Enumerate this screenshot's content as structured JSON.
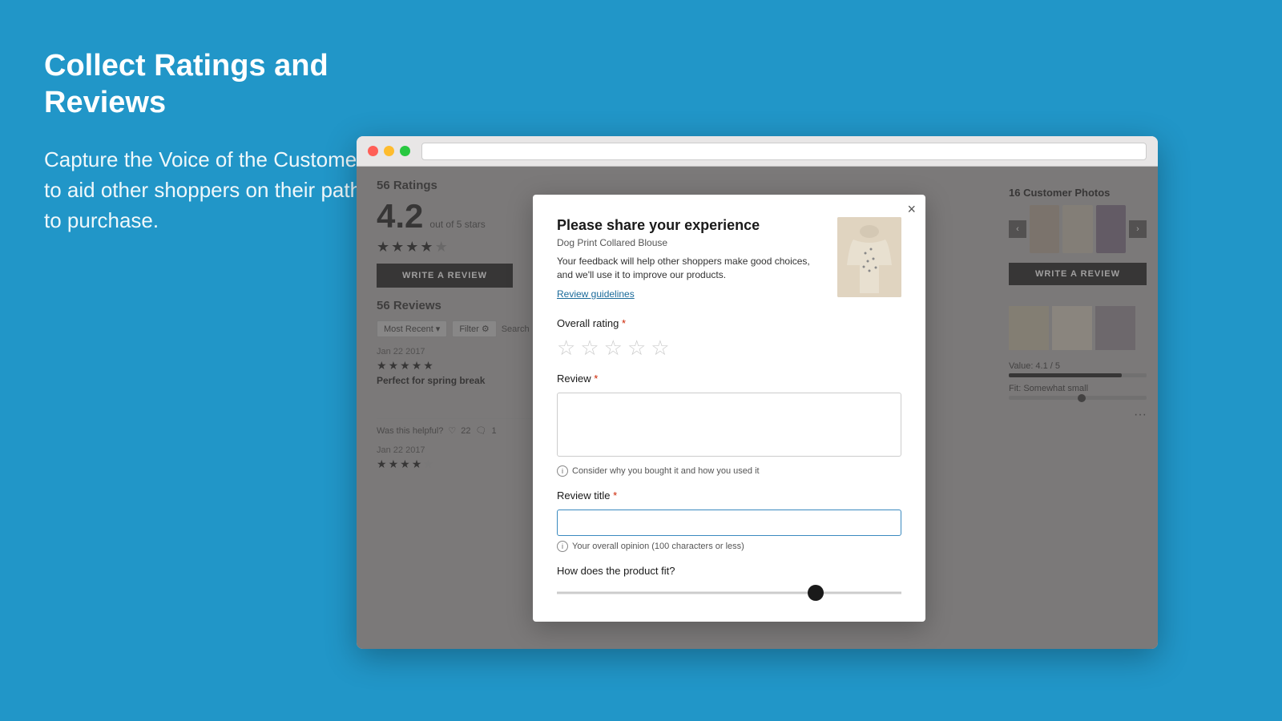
{
  "page": {
    "background_color": "#2196c8"
  },
  "left_panel": {
    "title": "Collect Ratings and Reviews",
    "subtitle": "Capture the Voice of the Customer to aid other shoppers on their path to purchase."
  },
  "browser": {
    "url_placeholder": ""
  },
  "product_page": {
    "ratings_count": "56 Ratings",
    "rating_value": "4.2",
    "rating_out_of": "out of 5 stars",
    "write_review_btn": "WRITE A REVIEW",
    "reviews_title": "56 Reviews",
    "filter_label": "Most Recent",
    "filter_btn": "Filter",
    "search_placeholder": "Search",
    "reviews": [
      {
        "date": "Jan 22 2017",
        "headline": "Perfect for spring break",
        "stars": 5
      },
      {
        "date": "Jan 22 2017",
        "stars": 4
      }
    ],
    "helpful_label": "Was this helpful?",
    "helpful_count": "22",
    "not_helpful_count": "1",
    "customer_photos_title": "16 Customer Photos",
    "right_write_review": "WRITE A REVIEW",
    "value_label": "Value: 4.1 / 5",
    "fit_label": "Fit: Somewhat small"
  },
  "modal": {
    "title": "Please share your experience",
    "product_name": "Dog Print Collared Blouse",
    "description": "Your feedback will help other shoppers make good choices, and we'll use it to improve our products.",
    "guidelines_link": "Review guidelines",
    "close_btn": "×",
    "overall_rating_label": "Overall rating",
    "review_label": "Review",
    "review_hint": "Consider why you bought it and how you used it",
    "review_title_label": "Review title",
    "review_title_hint": "Your overall opinion (100 characters or less)",
    "fit_title": "How does the product fit?",
    "stars": [
      "☆",
      "☆",
      "☆",
      "☆",
      "☆"
    ]
  }
}
